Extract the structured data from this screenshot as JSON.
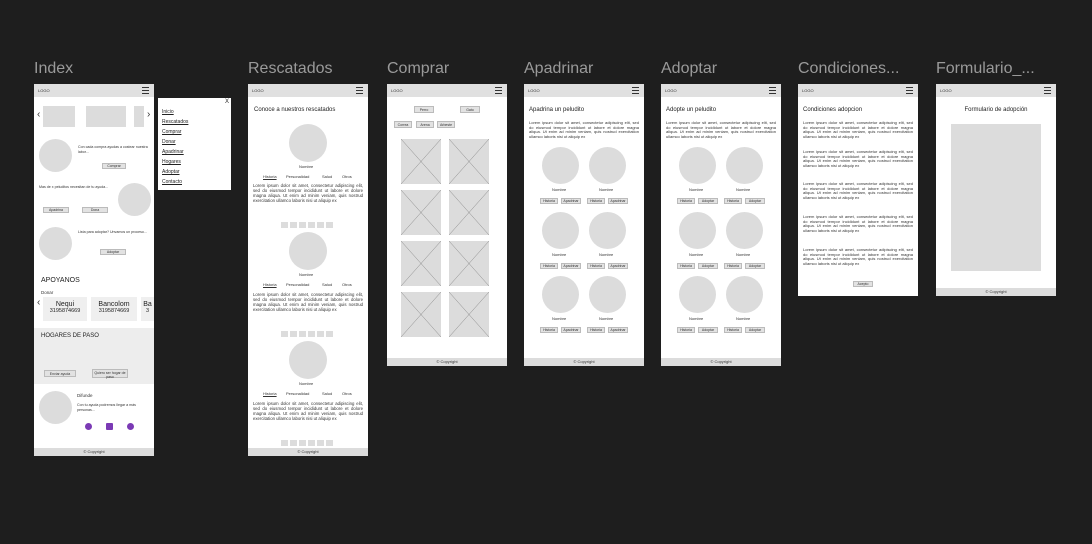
{
  "frames": {
    "index": {
      "label": "Index"
    },
    "rescatados": {
      "label": "Rescatados"
    },
    "comprar": {
      "label": "Comprar"
    },
    "apadrinar": {
      "label": "Apadrinar"
    },
    "adoptar": {
      "label": "Adoptar"
    },
    "condiciones": {
      "label": "Condiciones..."
    },
    "formulario": {
      "label": "Formulario_..."
    }
  },
  "common": {
    "logo": "LOGO",
    "copyright": "Copyright",
    "lorem": "Lorem ipsum dolor sit amet, consectetur adipiscing elit, sed do eiusmod tempor incididunt ut labore et dolore magna aliqua. Ut enim ad minim veniam, quis nostrud exercitation ullamco laboris nisi ut aliquip ex",
    "nombre": "Nombre"
  },
  "index": {
    "row1_text": "Con cada compra ayudas a costear nuestra labor...",
    "comprar_btn": "Comprar",
    "row2_text": "Mas de x peluditos necesitan de tu ayuda...",
    "apadrina_btn": "Apadrina",
    "dona_btn": "Dona",
    "row3_text": "Lista para adoptar? Unvamos un proceso...",
    "adoptar_btn": "Adoptar",
    "apoyanos": "APOYANOS",
    "donar": "Donar",
    "donations": [
      {
        "name": "Nequi",
        "number": "3195874669"
      },
      {
        "name": "Bancolom",
        "number": "3195874669"
      },
      {
        "name": "Ba",
        "number": "3"
      }
    ],
    "hogares": "HOGARES DE PASO",
    "enviar_btn": "Enviar ayuda",
    "quiero_btn": "Quiero ser hogar de paso",
    "difunde": "Difunde",
    "difunde_text": "Con tu ayuda podremos llegar a más personas..."
  },
  "menu": {
    "close": "X",
    "items": [
      "Inicio",
      "Rescatados",
      "Comprar",
      "Donar",
      "Apadrinar",
      "Hogares",
      "Adoptar",
      "Contacto"
    ]
  },
  "rescatados": {
    "title": "Conoce a nuestros rescatados",
    "tabs": [
      "Historia",
      "Personalidad",
      "Salud",
      "Otros"
    ]
  },
  "comprar": {
    "filters": [
      "Perro",
      "Gato"
    ],
    "categories": [
      "Correa",
      "Arena",
      "Arbeste"
    ]
  },
  "apadrinar": {
    "title": "Apadrina un peludito",
    "historia_btn": "Historia",
    "apadrinar_btn": "Apadrinar"
  },
  "adoptar": {
    "title": "Adopte un peludito",
    "historia_btn": "Historia",
    "adoptar_btn": "Adoptar"
  },
  "condiciones": {
    "title": "Condiciones adopcion",
    "acepto_btn": "Acepto"
  },
  "formulario": {
    "title": "Formulario de adopción"
  }
}
